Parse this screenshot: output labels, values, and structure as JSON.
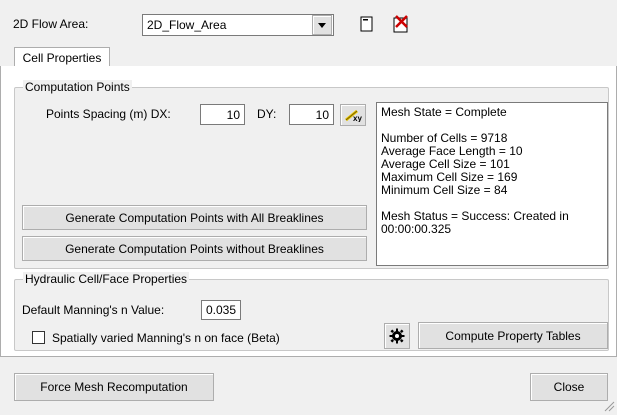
{
  "header": {
    "flow_area_label": "2D Flow Area:",
    "flow_area_value": "2D_Flow_Area"
  },
  "tabs": [
    {
      "label": "Cell Properties"
    }
  ],
  "computation_points": {
    "group_label": "Computation Points",
    "spacing_label": "Points Spacing (m) DX:",
    "dx_value": "10",
    "dy_label": "DY:",
    "dy_value": "10",
    "gen_with_breaklines": "Generate Computation Points with All Breaklines",
    "gen_without_breaklines": "Generate Computation Points without Breaklines"
  },
  "mesh_info": {
    "lines": [
      "Mesh State = Complete",
      "",
      "Number of Cells = 9718",
      "Average Face Length = 10",
      "Average Cell Size = 101",
      "Maximum Cell Size = 169",
      "Minimum Cell Size = 84",
      "",
      "Mesh Status = Success: Created in",
      "00:00:00.325"
    ]
  },
  "hydraulic": {
    "group_label": "Hydraulic Cell/Face Properties",
    "manning_label": "Default Manning's n Value:",
    "manning_value": "0.035",
    "spatially_varied_label": "Spatially varied Manning's n on face (Beta)",
    "spatially_varied_checked": false,
    "compute_tables_label": "Compute Property Tables"
  },
  "footer": {
    "force_recompute_label": "Force Mesh Recomputation",
    "close_label": "Close"
  },
  "icons": {
    "edit": "edit-icon",
    "delete": "delete-icon",
    "pick": "pencil-pick-icon",
    "settings": "gear-icon"
  },
  "colors": {
    "window_bg": "#f0f0f0",
    "border": "#adadad",
    "delete_red": "#cc0000",
    "pick_yellow": "#e6c800"
  }
}
